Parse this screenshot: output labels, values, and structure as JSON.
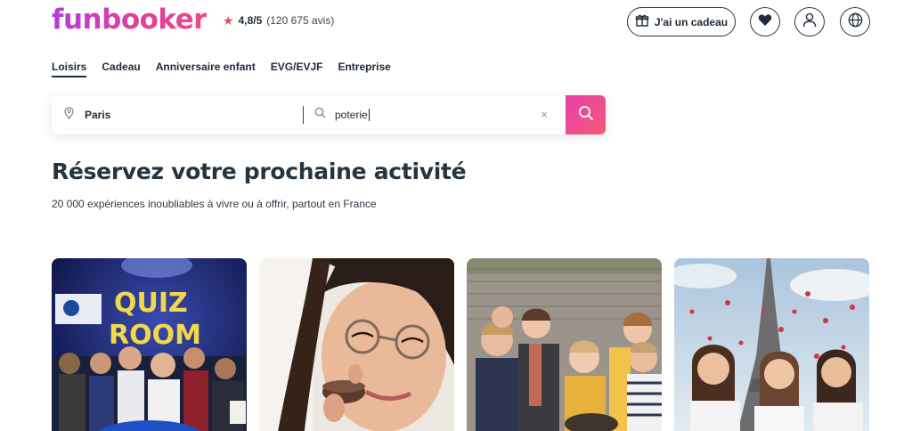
{
  "brand": {
    "logo": "funbooker"
  },
  "rating": {
    "score": "4,8/5",
    "reviews": "(120 675 avis)"
  },
  "header_actions": {
    "gift_label": "J'ai un cadeau"
  },
  "nav": {
    "items": [
      {
        "label": "Loisirs",
        "active": true
      },
      {
        "label": "Cadeau"
      },
      {
        "label": "Anniversaire enfant"
      },
      {
        "label": "EVG/EVJF"
      },
      {
        "label": "Entreprise"
      }
    ]
  },
  "search": {
    "location_value": "Paris",
    "activity_value": "poterie",
    "clear_symbol": "×"
  },
  "hero": {
    "title": "Réservez votre prochaine activité",
    "subtitle": "20 000 expériences inoubliables à vivre ou à offrir, partout en France"
  },
  "cards": [
    {
      "image": "quiz-room-photo",
      "sign_text": "QUIZ ROOM"
    },
    {
      "image": "macaron-woman-photo"
    },
    {
      "image": "children-group-photo"
    },
    {
      "image": "eiffel-tower-friends-photo"
    }
  ],
  "colors": {
    "brand_gradient_start": "#b13ee0",
    "brand_gradient_end": "#f0468a",
    "star": "#e94b63",
    "text": "#1f2a37"
  }
}
